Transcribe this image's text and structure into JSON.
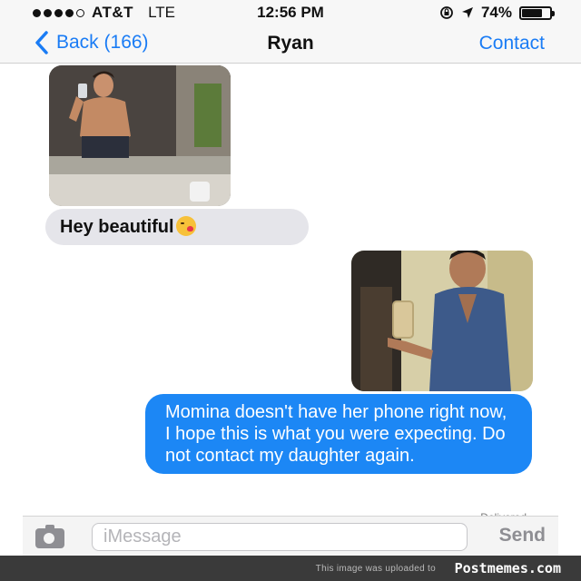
{
  "status_bar": {
    "carrier": "AT&T",
    "network": "LTE",
    "time": "12:56 PM",
    "battery": "74%",
    "battery_level": 0.74,
    "signal_bars_filled": 4,
    "signal_bars_total": 5
  },
  "nav": {
    "back_label": "Back (166)",
    "title": "Ryan",
    "contact_label": "Contact"
  },
  "messages": [
    {
      "type": "image",
      "direction": "incoming",
      "description_icon": "photo-icon"
    },
    {
      "type": "text",
      "direction": "incoming",
      "text": "Hey beautiful",
      "emoji": "kissing-face-emoji"
    },
    {
      "type": "image",
      "direction": "outgoing",
      "description_icon": "photo-icon"
    },
    {
      "type": "text",
      "direction": "outgoing",
      "text": "Momina doesn't have her phone right now, I hope this is what you were expecting. Do not contact my daughter again."
    }
  ],
  "delivered_label": "Delivered",
  "composer": {
    "placeholder": "iMessage",
    "send_label": "Send",
    "camera_icon": "camera-icon"
  },
  "watermark": {
    "text": "This image was uploaded to",
    "brand": "Postmemes.com"
  },
  "colors": {
    "accent": "#1a7cf5",
    "outgoing_bubble": "#1c87f5",
    "incoming_bubble": "#e5e5ea"
  }
}
